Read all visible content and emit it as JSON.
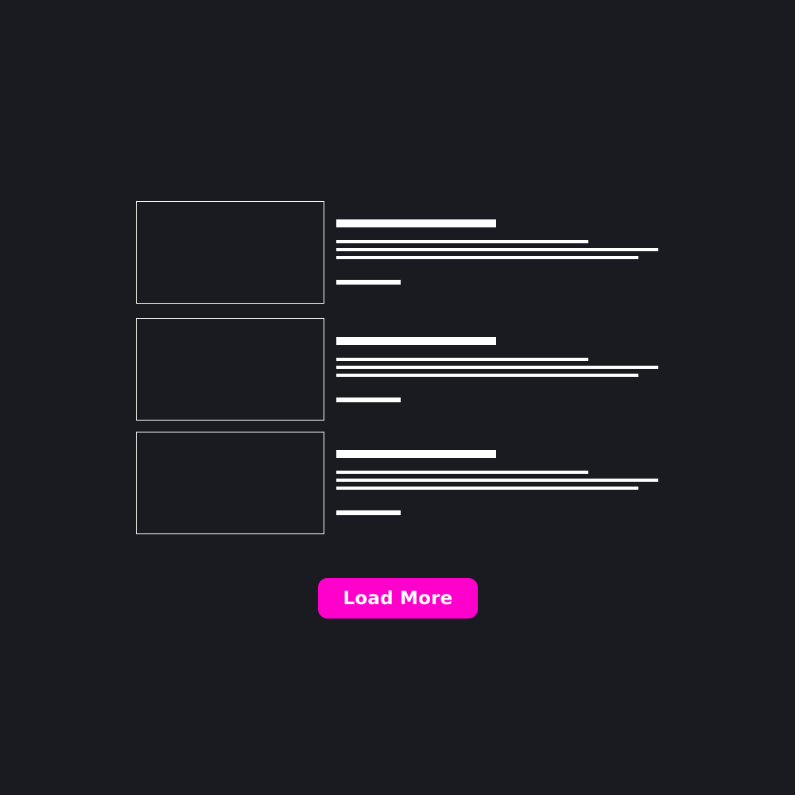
{
  "feed": {
    "items": [
      {
        "kind": "placeholder-card"
      },
      {
        "kind": "placeholder-card"
      },
      {
        "kind": "placeholder-card"
      }
    ]
  },
  "actions": {
    "load_more_label": "Load More"
  },
  "colors": {
    "background": "#1a1a21",
    "placeholder": "#ffffff",
    "accent": "#ff00cc"
  }
}
